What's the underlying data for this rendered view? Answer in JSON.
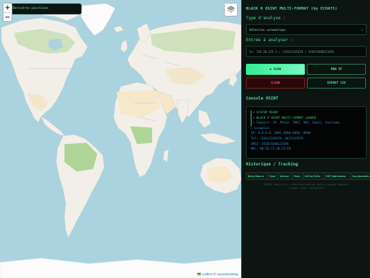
{
  "map": {
    "zoom_in": "+",
    "zoom_out": "−",
    "positions_label": "Dernières positions",
    "attribution_leaflet": "Leaflet",
    "attribution_sep": " | © ",
    "attribution_osm": "OpenStreetMap",
    "layers_icon": "layers-icon"
  },
  "panel": {
    "title": "BLACK H OSINT MULTI-FORMAT (by ECHATS)",
    "analysis_type_label": "Type d'analyse :",
    "analysis_type_value": "Détection automatique",
    "input_label": "Entrée à analyser :",
    "input_placeholder": "Ex: 156.38.225.3 / +33612345678 / 355874680123456",
    "scan_label": "▶ SCAN",
    "myip_label": "MON IP",
    "clear_label": "CLEAR",
    "export_label": "EXPORT CSV",
    "console_title": "Console OSINT",
    "console_lines": [
      "> SYSTEM READY",
      "> BLACK H OSINT MULTI-FORMAT LOADED",
      "> Support: IP, Phone, IMEI, MAC, Email, Username",
      "> Exemples:",
      "IP: 8.8.8.8, 2001:4860:4860::8888",
      "Tel: +33612345678, 0612345678",
      "IMEI: 355874680123456",
      "MAC: 00:50:C2:3B:CA:FB"
    ],
    "history_title": "Historique / Tracking",
    "history_columns": [
      "Date/Heure",
      "Type",
      "Valeur",
      "Pays",
      "Ville/Info",
      "ISP/Opérateur",
      "Coordonnées"
    ],
    "footer_line1": "OSINT Tool v2.0 • Géolocalisation multi-format support",
    "footer_line2": "• Usage légal uniquement"
  },
  "colors": {
    "accent": "#4de39b",
    "danger": "#ff5252",
    "water": "#aad3df",
    "land": "#f2efe9",
    "forest": "#b9d8a5",
    "desert": "#f5e7c8",
    "ice": "#fbfbfb"
  }
}
